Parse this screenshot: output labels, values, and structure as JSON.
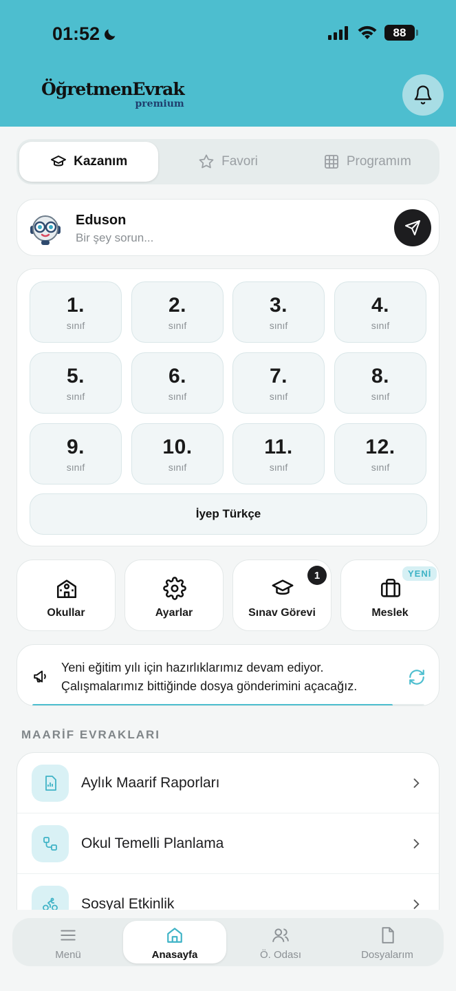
{
  "status_bar": {
    "time": "01:52",
    "battery": "88"
  },
  "app": {
    "logo_main": "ÖğretmenEvrak",
    "logo_sub": "premium"
  },
  "segment": {
    "tabs": [
      {
        "label": "Kazanım",
        "icon": "graduation-cap-icon",
        "active": true
      },
      {
        "label": "Favori",
        "icon": "star-icon",
        "active": false
      },
      {
        "label": "Programım",
        "icon": "grid-icon",
        "active": false
      }
    ]
  },
  "assistant": {
    "name": "Eduson",
    "placeholder": "Bir şey sorun..."
  },
  "grades": {
    "items": [
      {
        "num": "1.",
        "label": "sınıf"
      },
      {
        "num": "2.",
        "label": "sınıf"
      },
      {
        "num": "3.",
        "label": "sınıf"
      },
      {
        "num": "4.",
        "label": "sınıf"
      },
      {
        "num": "5.",
        "label": "sınıf"
      },
      {
        "num": "6.",
        "label": "sınıf"
      },
      {
        "num": "7.",
        "label": "sınıf"
      },
      {
        "num": "8.",
        "label": "sınıf"
      },
      {
        "num": "9.",
        "label": "sınıf"
      },
      {
        "num": "10.",
        "label": "sınıf"
      },
      {
        "num": "11.",
        "label": "sınıf"
      },
      {
        "num": "12.",
        "label": "sınıf"
      }
    ],
    "extra": "İyep Türkçe"
  },
  "quick_actions": [
    {
      "label": "Okullar",
      "icon": "school-icon"
    },
    {
      "label": "Ayarlar",
      "icon": "gear-icon"
    },
    {
      "label": "Sınav Görevi",
      "icon": "graduation-cap-icon",
      "badge": "1"
    },
    {
      "label": "Meslek",
      "icon": "briefcase-icon",
      "badge": "YENİ"
    }
  ],
  "notice": {
    "line1": "Yeni eğitim yılı için hazırlıklarımız devam ediyor.",
    "line2": "Çalışmalarımız bittiğinde dosya gönderimini açacağız.",
    "progress": 0.92
  },
  "section": {
    "title": "MAARİF EVRAKLARI",
    "items": [
      {
        "label": "Aylık Maarif Raporları",
        "icon": "report-icon"
      },
      {
        "label": "Okul Temelli Planlama",
        "icon": "workflow-icon"
      },
      {
        "label": "Sosyal Etkinlik",
        "icon": "bike-icon"
      }
    ]
  },
  "tabbar": {
    "items": [
      {
        "label": "Menü",
        "icon": "menu-icon",
        "active": false
      },
      {
        "label": "Anasayfa",
        "icon": "home-icon",
        "active": true
      },
      {
        "label": "Ö. Odası",
        "icon": "users-icon",
        "active": false
      },
      {
        "label": "Dosyalarım",
        "icon": "file-icon",
        "active": false
      }
    ]
  },
  "colors": {
    "accent": "#4dbecf",
    "background": "#f4f6f6",
    "dark": "#1d1d1f"
  }
}
